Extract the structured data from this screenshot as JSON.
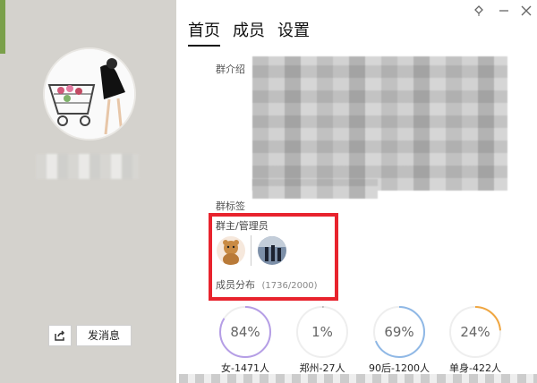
{
  "tabs": [
    {
      "label": "首页"
    },
    {
      "label": "成员"
    },
    {
      "label": "设置"
    }
  ],
  "sidebar": {
    "send_message_label": "发消息"
  },
  "group": {
    "intro_label": "群介绍",
    "tags_label": "群标签",
    "admins_label": "群主/管理员",
    "distribution_label": "成员分布",
    "distribution_count": "(1736/2000)"
  },
  "stats": [
    {
      "percent": "84%",
      "label": "女-1471人",
      "value": 84,
      "color": "#b59ee6"
    },
    {
      "percent": "1%",
      "label": "郑州-27人",
      "value": 1,
      "color": "#bdbdbd"
    },
    {
      "percent": "69%",
      "label": "90后-1200人",
      "value": 69,
      "color": "#8fb8e6"
    },
    {
      "percent": "24%",
      "label": "单身-422人",
      "value": 24,
      "color": "#f0a640"
    }
  ]
}
